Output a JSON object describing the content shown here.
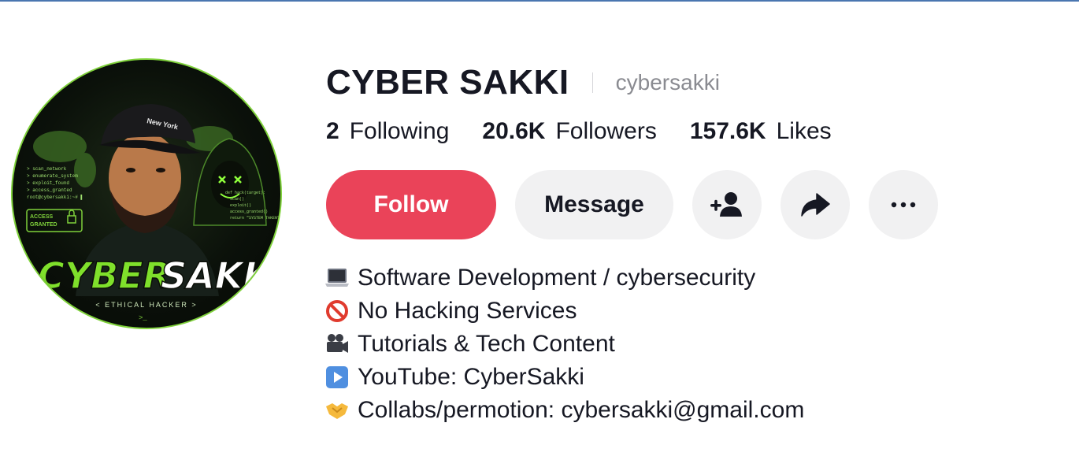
{
  "profile": {
    "display_name": "CYBER SAKKI",
    "username": "cybersakki",
    "avatar_text": {
      "brand_left": "CYBER",
      "brand_right": "SAKKI",
      "tagline": "< ETHICAL HACKER >",
      "cap_text": "New York",
      "access_line1": "ACCESS",
      "access_line2": "GRANTED",
      "terminal_lines": [
        "> scan_network",
        "> enumerate_system",
        "> exploit_found",
        "> access_granted",
        "root@cybersakki:~# ▌"
      ],
      "code_lines": [
        "def hack(target):",
        "scan()",
        "exploit()",
        "access_granted()",
        "return \"SYSTEM TAKEN\""
      ],
      "prompt": ">_"
    }
  },
  "stats": [
    {
      "value": "2",
      "label": "Following"
    },
    {
      "value": "20.6K",
      "label": "Followers"
    },
    {
      "value": "157.6K",
      "label": "Likes"
    }
  ],
  "actions": {
    "follow_label": "Follow",
    "message_label": "Message",
    "icons": [
      "add-friend-icon",
      "share-icon",
      "more-icon"
    ]
  },
  "bio": [
    {
      "icon": "laptop-icon",
      "text": "Software Development / cybersecurity"
    },
    {
      "icon": "prohibited-icon",
      "text": "No Hacking Services"
    },
    {
      "icon": "movie-camera-icon",
      "text": "Tutorials & Tech Content"
    },
    {
      "icon": "play-button-icon",
      "text": "YouTube: CyberSakki"
    },
    {
      "icon": "handshake-icon",
      "text": "Collabs/permotion: cybersakki@gmail.com"
    }
  ],
  "colors": {
    "follow": "#ea4359",
    "secondary_button": "#f1f1f2",
    "text": "#161823",
    "muted": "#8a8b91",
    "avatar_accent": "#7fd13b"
  }
}
